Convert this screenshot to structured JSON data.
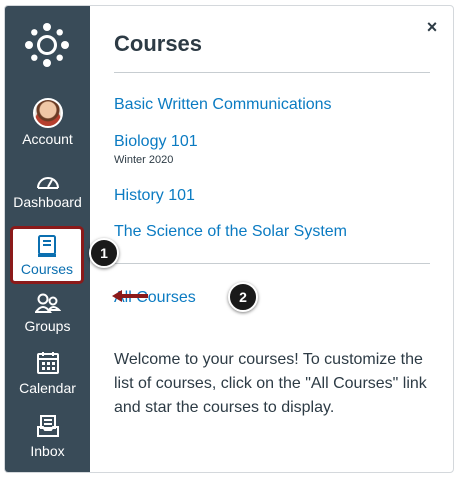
{
  "nav": {
    "items": [
      {
        "label": "Account",
        "icon": "avatar"
      },
      {
        "label": "Dashboard",
        "icon": "dashboard-icon"
      },
      {
        "label": "Courses",
        "icon": "courses-icon"
      },
      {
        "label": "Groups",
        "icon": "groups-icon"
      },
      {
        "label": "Calendar",
        "icon": "calendar-icon"
      },
      {
        "label": "Inbox",
        "icon": "inbox-icon"
      }
    ],
    "active_item": "Courses"
  },
  "tray": {
    "title": "Courses",
    "close_label": "×",
    "courses": [
      {
        "name": "Basic Written Communications",
        "term": ""
      },
      {
        "name": "Biology 101",
        "term": "Winter 2020"
      },
      {
        "name": "History 101",
        "term": ""
      },
      {
        "name": "The Science of the Solar System",
        "term": ""
      }
    ],
    "all_courses_label": "All Courses",
    "welcome_text": "Welcome to your courses! To customize the list of courses, click on the \"All Courses\" link and star the courses to display."
  },
  "callouts": [
    "1",
    "2"
  ],
  "colors": {
    "nav_bg": "#394b58",
    "link": "#0b7bc2",
    "highlight_border": "#8b1a1a",
    "text": "#2d3b45"
  }
}
